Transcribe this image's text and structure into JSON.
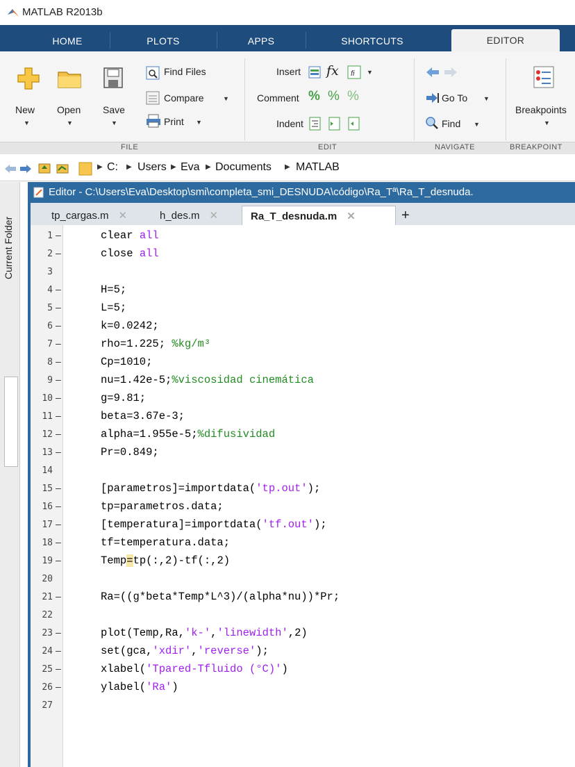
{
  "window": {
    "title": "MATLAB R2013b"
  },
  "tabs": [
    "HOME",
    "PLOTS",
    "APPS",
    "SHORTCUTS",
    "EDITOR"
  ],
  "ribbon": {
    "file": {
      "new": "New",
      "open": "Open",
      "save": "Save",
      "find_files": "Find Files",
      "compare": "Compare",
      "print": "Print",
      "group": "FILE"
    },
    "edit": {
      "insert": "Insert",
      "comment": "Comment",
      "indent": "Indent",
      "group": "EDIT"
    },
    "navigate": {
      "go_to": "Go To",
      "find": "Find",
      "group": "NAVIGATE"
    },
    "breakpoints": {
      "label": "Breakpoints",
      "group": "BREAKPOINT"
    }
  },
  "address": {
    "crumbs": [
      "C:",
      "Users",
      "Eva",
      "Documents",
      "MATLAB"
    ]
  },
  "dock": {
    "label": "Current Folder"
  },
  "editor": {
    "header": "Editor - C:\\Users\\Eva\\Desktop\\smi\\completa_smi_DESNUDA\\código\\Ra_Tª\\Ra_T_desnuda.",
    "tabs": [
      "tp_cargas.m",
      "h_des.m",
      "Ra_T_desnuda.m"
    ],
    "add_tab": "+",
    "line_numbers": [
      "1",
      "2",
      "3",
      "4",
      "5",
      "6",
      "7",
      "8",
      "9",
      "10",
      "11",
      "12",
      "13",
      "14",
      "15",
      "16",
      "17",
      "18",
      "19",
      "20",
      "21",
      "22",
      "23",
      "24",
      "25",
      "26",
      "27"
    ],
    "dash": "–",
    "code": {
      "l1a": "clear ",
      "l1b": "all",
      "l2a": "close ",
      "l2b": "all",
      "l4": "H=5;",
      "l5": "L=5;",
      "l6": "k=0.0242;",
      "l7a": "rho=1.225; ",
      "l7b": "%kg/m³",
      "l8": "Cp=1010;",
      "l9a": "nu=1.42e-5;",
      "l9b": "%viscosidad cinemática",
      "l10": "g=9.81;",
      "l11": "beta=3.67e-3;",
      "l12a": "alpha=1.955e-5;",
      "l12b": "%difusividad",
      "l13": "Pr=0.849;",
      "l15a": "[parametros]=importdata(",
      "l15b": "'tp.out'",
      "l15c": ");",
      "l16": "tp=parametros.data;",
      "l17a": "[temperatura]=importdata(",
      "l17b": "'tf.out'",
      "l17c": ");",
      "l18": "tf=temperatura.data;",
      "l19a": "Temp",
      "l19b": "=",
      "l19c": "tp(:,2)-tf(:,2)",
      "l21": "Ra=((g*beta*Temp*L^3)/(alpha*nu))*Pr;",
      "l23a": "plot(Temp,Ra,",
      "l23b": "'k-'",
      "l23c": ",",
      "l23d": "'linewidth'",
      "l23e": ",2)",
      "l24a": "set(gca,",
      "l24b": "'xdir'",
      "l24c": ",",
      "l24d": "'reverse'",
      "l24e": ");",
      "l25a": "xlabel(",
      "l25b": "'Tpared-Tfluido (°C)'",
      "l25c": ")",
      "l26a": "ylabel(",
      "l26b": "'Ra'",
      "l26c": ")"
    }
  }
}
